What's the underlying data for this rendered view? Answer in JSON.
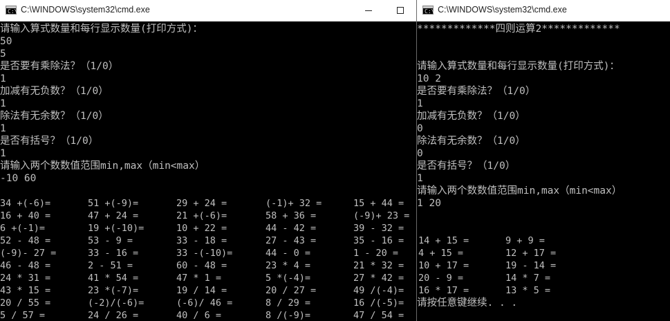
{
  "left_window": {
    "title": "C:\\WINDOWS\\system32\\cmd.exe",
    "icon": "cmd-icon",
    "controls": {
      "minimize": "minimize-icon",
      "maximize": "maximize-icon"
    },
    "lines": [
      "请输入算式数量和每行显示数量(打印方式)：",
      "50",
      "5",
      "是否要有乘除法？（1/0）",
      "1",
      "加减有无负数？（1/0）",
      "1",
      "除法有无余数？（1/0）",
      "1",
      "是否有括号？（1/0）",
      "1",
      "请输入两个数数值范围min,max（min<max）",
      "-10 60",
      ""
    ],
    "grid": [
      [
        "34 +(-6)=",
        "51 +(-9)=",
        "29 + 24 =",
        "(-1)+ 32 =",
        "15 + 44 ="
      ],
      [
        "16 + 40 =",
        "47 + 24 =",
        "21 +(-6)=",
        "58 + 36 =",
        "(-9)+ 23 ="
      ],
      [
        "6 +(-1)=",
        "19 +(-10)=",
        "10 + 22 =",
        "44 - 42 =",
        "39 - 32 ="
      ],
      [
        "52 - 48 =",
        "53 - 9 =",
        "33 - 18 =",
        "27 - 43 =",
        "35 - 16 ="
      ],
      [
        "(-9)- 27 =",
        "33 - 16 =",
        "33 -(-10)=",
        "44 - 0 =",
        "1 - 20 ="
      ],
      [
        "46 - 48 =",
        "2 - 51 =",
        "60 - 48 =",
        "23 * 4 =",
        "21 * 32 ="
      ],
      [
        "24 * 31 =",
        "41 * 54 =",
        "47 * 1 =",
        "5 *(-4)=",
        "27 * 42 ="
      ],
      [
        "43 * 15 =",
        "23 *(-7)=",
        "19 / 14 =",
        "20 / 27 =",
        "49 /(-4)="
      ],
      [
        "20 / 55 =",
        "(-2)/(-6)=",
        "(-6)/ 46 =",
        "8 / 29 =",
        "16 /(-5)="
      ],
      [
        "5 / 57 =",
        "24 / 26 =",
        "40 / 6 =",
        "8 /(-9)=",
        "47 / 54 ="
      ]
    ]
  },
  "right_window": {
    "title": "C:\\WINDOWS\\system32\\cmd.exe",
    "icon": "cmd-icon",
    "lines": [
      "*************四则运算2*************",
      "",
      "",
      "请输入算式数量和每行显示数量(打印方式)：",
      "10 2",
      "是否要有乘除法？（1/0）",
      "1",
      "加减有无负数？（1/0）",
      "0",
      "除法有无余数？（1/0）",
      "0",
      "是否有括号？（1/0）",
      "1",
      "请输入两个数数值范围min,max（min<max）",
      "1 20",
      "",
      ""
    ],
    "grid": [
      [
        "14 + 15 =",
        "9 + 9 ="
      ],
      [
        "4 + 15 =",
        "12 + 17 ="
      ],
      [
        "10 + 17 =",
        "19 - 14 ="
      ],
      [
        "20 - 9 =",
        "14 * 7 ="
      ],
      [
        "16 * 17 =",
        "13 * 5 ="
      ]
    ],
    "footer": "请按任意键继续. . ."
  }
}
